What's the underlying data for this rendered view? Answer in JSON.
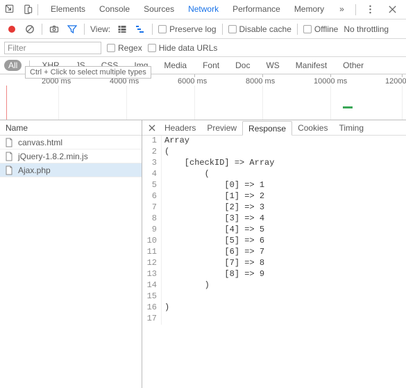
{
  "tabs": {
    "items": [
      "Elements",
      "Console",
      "Sources",
      "Network",
      "Performance",
      "Memory"
    ],
    "active": "Network"
  },
  "toolbar": {
    "view_label": "View:",
    "preserve_log": "Preserve log",
    "disable_cache": "Disable cache",
    "offline": "Offline",
    "no_throttling": "No throttling"
  },
  "filterbar": {
    "filter_placeholder": "Filter",
    "regex": "Regex",
    "hide_data_urls": "Hide data URLs"
  },
  "types": {
    "items": [
      "All",
      "XHR",
      "JS",
      "CSS",
      "Img",
      "Media",
      "Font",
      "Doc",
      "WS",
      "Manifest",
      "Other"
    ],
    "active": "All",
    "tooltip": "Ctrl + Click to select multiple types"
  },
  "timeline": {
    "labels": [
      "2000 ms",
      "4000 ms",
      "6000 ms",
      "8000 ms",
      "10000 ms",
      "12000"
    ]
  },
  "requests": {
    "header": "Name",
    "items": [
      "canvas.html",
      "jQuery-1.8.2.min.js",
      "Ajax.php"
    ],
    "selected": 2
  },
  "detail": {
    "tabs": [
      "Headers",
      "Preview",
      "Response",
      "Cookies",
      "Timing"
    ],
    "active": "Response",
    "code": [
      "Array",
      "(",
      "    [checkID] => Array",
      "        (",
      "            [0] => 1",
      "            [1] => 2",
      "            [2] => 3",
      "            [3] => 4",
      "            [4] => 5",
      "            [5] => 6",
      "            [6] => 7",
      "            [7] => 8",
      "            [8] => 9",
      "        )",
      "",
      ")",
      ""
    ]
  }
}
